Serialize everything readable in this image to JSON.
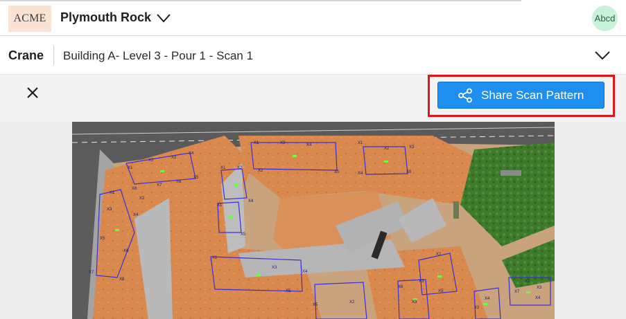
{
  "header": {
    "logo_text": "ACME",
    "project_name": "Plymouth Rock",
    "user_initials": "Abcd"
  },
  "subheader": {
    "crane_label": "Crane",
    "scan_title": "Building A- Level 3 - Pour 1 - Scan 1"
  },
  "toolbar": {
    "share_label": "Share Scan Pattern"
  },
  "colors": {
    "accent": "#1e8ef0",
    "highlight": "#e0141b",
    "logo_bg": "#fbe3d3",
    "avatar_bg": "#c8f2d9",
    "scan_outline": "#3a2fd6"
  },
  "icons": {
    "project_dropdown": "chevron-down-icon",
    "scan_dropdown": "chevron-down-icon",
    "close": "close-icon",
    "share": "share-icon"
  },
  "map": {
    "markers": [
      "X1",
      "X2",
      "X3",
      "X4",
      "X5",
      "X6",
      "X7",
      "X8"
    ]
  }
}
